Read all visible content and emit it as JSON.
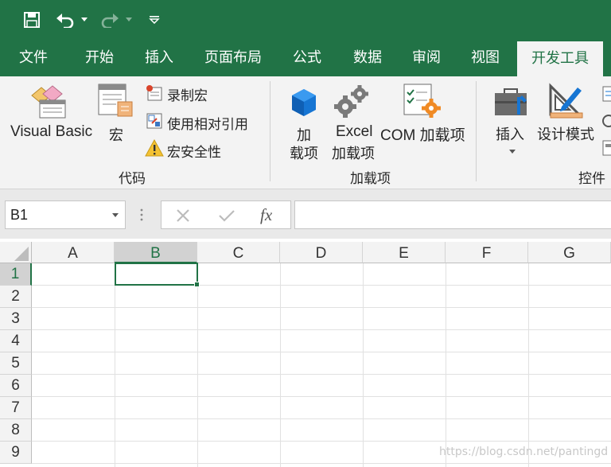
{
  "quick_access": {
    "save_icon": "save-icon",
    "undo_icon": "undo-icon",
    "redo_icon": "redo-icon",
    "customize_icon": "customize-qat-icon"
  },
  "tabs": [
    "文件",
    "开始",
    "插入",
    "页面布局",
    "公式",
    "数据",
    "审阅",
    "视图",
    "开发工具"
  ],
  "active_tab": "开发工具",
  "ribbon": {
    "code_group": {
      "label": "代码",
      "visual_basic": "Visual Basic",
      "macros": "宏",
      "record_macro": "录制宏",
      "relative_refs": "使用相对引用",
      "macro_security": "宏安全性"
    },
    "addins_group": {
      "label": "加载项",
      "addins_line1": "加",
      "addins_line2": "载项",
      "excel_addins_line1": "Excel",
      "excel_addins_line2": "加载项",
      "com_addins": "COM 加载项"
    },
    "controls_group": {
      "label": "控件",
      "insert": "插入",
      "design_mode": "设计模式"
    }
  },
  "formula_bar": {
    "name_box": "B1",
    "cancel_icon": "cancel-icon",
    "enter_icon": "check-icon",
    "fx_label": "fx",
    "formula_value": ""
  },
  "sheet": {
    "columns": [
      "A",
      "B",
      "C",
      "D",
      "E",
      "F",
      "G"
    ],
    "rows": [
      "1",
      "2",
      "3",
      "4",
      "5",
      "6",
      "7",
      "8",
      "9"
    ],
    "selected_cell": "B1"
  },
  "watermark": "https://blog.csdn.net/pantingd",
  "colors": {
    "brand": "#217346",
    "ribbon_bg": "#f3f3f3"
  }
}
